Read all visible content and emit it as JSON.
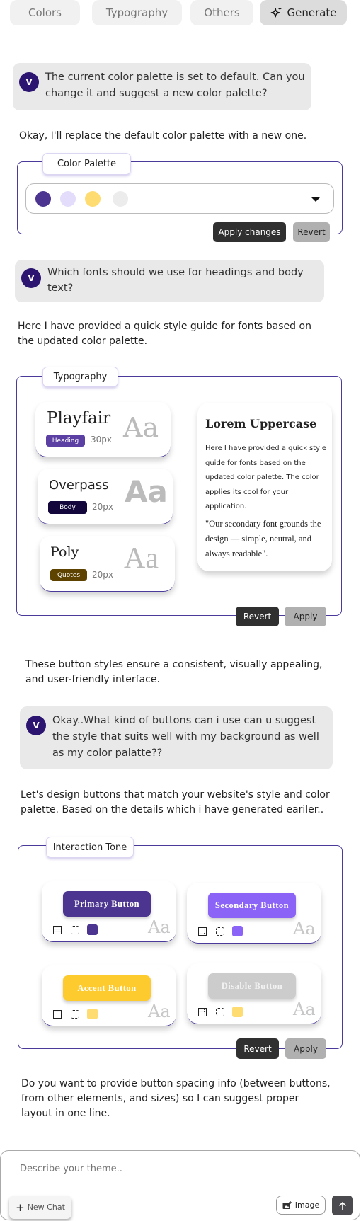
{
  "tabs": [
    {
      "label": "Colors"
    },
    {
      "label": "Typography"
    },
    {
      "label": "Others"
    },
    {
      "label": "Generate",
      "icon": "sparkle-icon",
      "active": true
    }
  ],
  "avatar_initial": "V",
  "messages": {
    "user1": "The current color palette is set to default. Can you change it and suggest a new color palette?",
    "reply1": "Okay, I'll replace the default color palette with a new one.",
    "user2": "Which fonts should we use for headings and body text?",
    "reply2": "Here I have provided a quick style guide for fonts based on the updated color palette.",
    "reply3": "These button styles ensure a consistent, visually appealing, and user-friendly interface.",
    "user3": "Okay..What kind of buttons can i use can u suggest the style that suits well with my background as well as my color palatte??",
    "reply4": "Let's design buttons that match your website's style and color palette. Based on the details which i have generated eariler..",
    "reply5": "Do you  want to  provide button spacing info (between buttons, from other elements, and sizes) so I can suggest proper layout in one line."
  },
  "color_palette": {
    "title": "Color Palette",
    "swatches": [
      "#4b3590",
      "#e3dcfb",
      "#fedc72",
      "#ececec"
    ],
    "apply_label": "Apply changes",
    "revert_label": "Revert"
  },
  "typography": {
    "title": "Typography",
    "fonts": [
      {
        "name": "Playfair",
        "role": "Heading",
        "size": "30px",
        "color": "#5b3fa3",
        "sample": "Aa"
      },
      {
        "name": "Overpass",
        "role": "Body",
        "size": "20px",
        "color": "#12063a",
        "sample": "Aa"
      },
      {
        "name": "Poly",
        "role": "Quotes",
        "size": "20px",
        "color": "#5e4300",
        "sample": "Aa"
      }
    ],
    "preview": {
      "heading": "Lorem Uppercase",
      "body": "Here I have provided a quick style guide for fonts based on the updated color palette. The color applies its cool for your application.",
      "quote": "\"Our secondary font grounds the design — simple, neutral, and always readable\"."
    },
    "revert_label": "Revert",
    "apply_label": "Apply"
  },
  "interaction": {
    "title": "Interaction Tone",
    "buttons": [
      {
        "label": "Primary Button",
        "color": "#4b3590",
        "text_color": "#ffffff",
        "swatch": "#4b3590"
      },
      {
        "label": "Secondary Button",
        "color": "#8b63f7",
        "text_color": "#ffffff",
        "swatch": "#8b63f7"
      },
      {
        "label": "Accent Button",
        "color": "#fecb2e",
        "text_color": "#ffffff",
        "swatch": "#fedc72"
      },
      {
        "label": "Disable Button",
        "color": "#cccccc",
        "text_color": "#f2f2f2",
        "swatch": "#fedc72"
      }
    ],
    "sample": "Aa",
    "revert_label": "Revert",
    "apply_label": "Apply"
  },
  "composer": {
    "placeholder": "Describe your theme..",
    "new_chat_label": "New Chat",
    "image_label": "Image"
  }
}
